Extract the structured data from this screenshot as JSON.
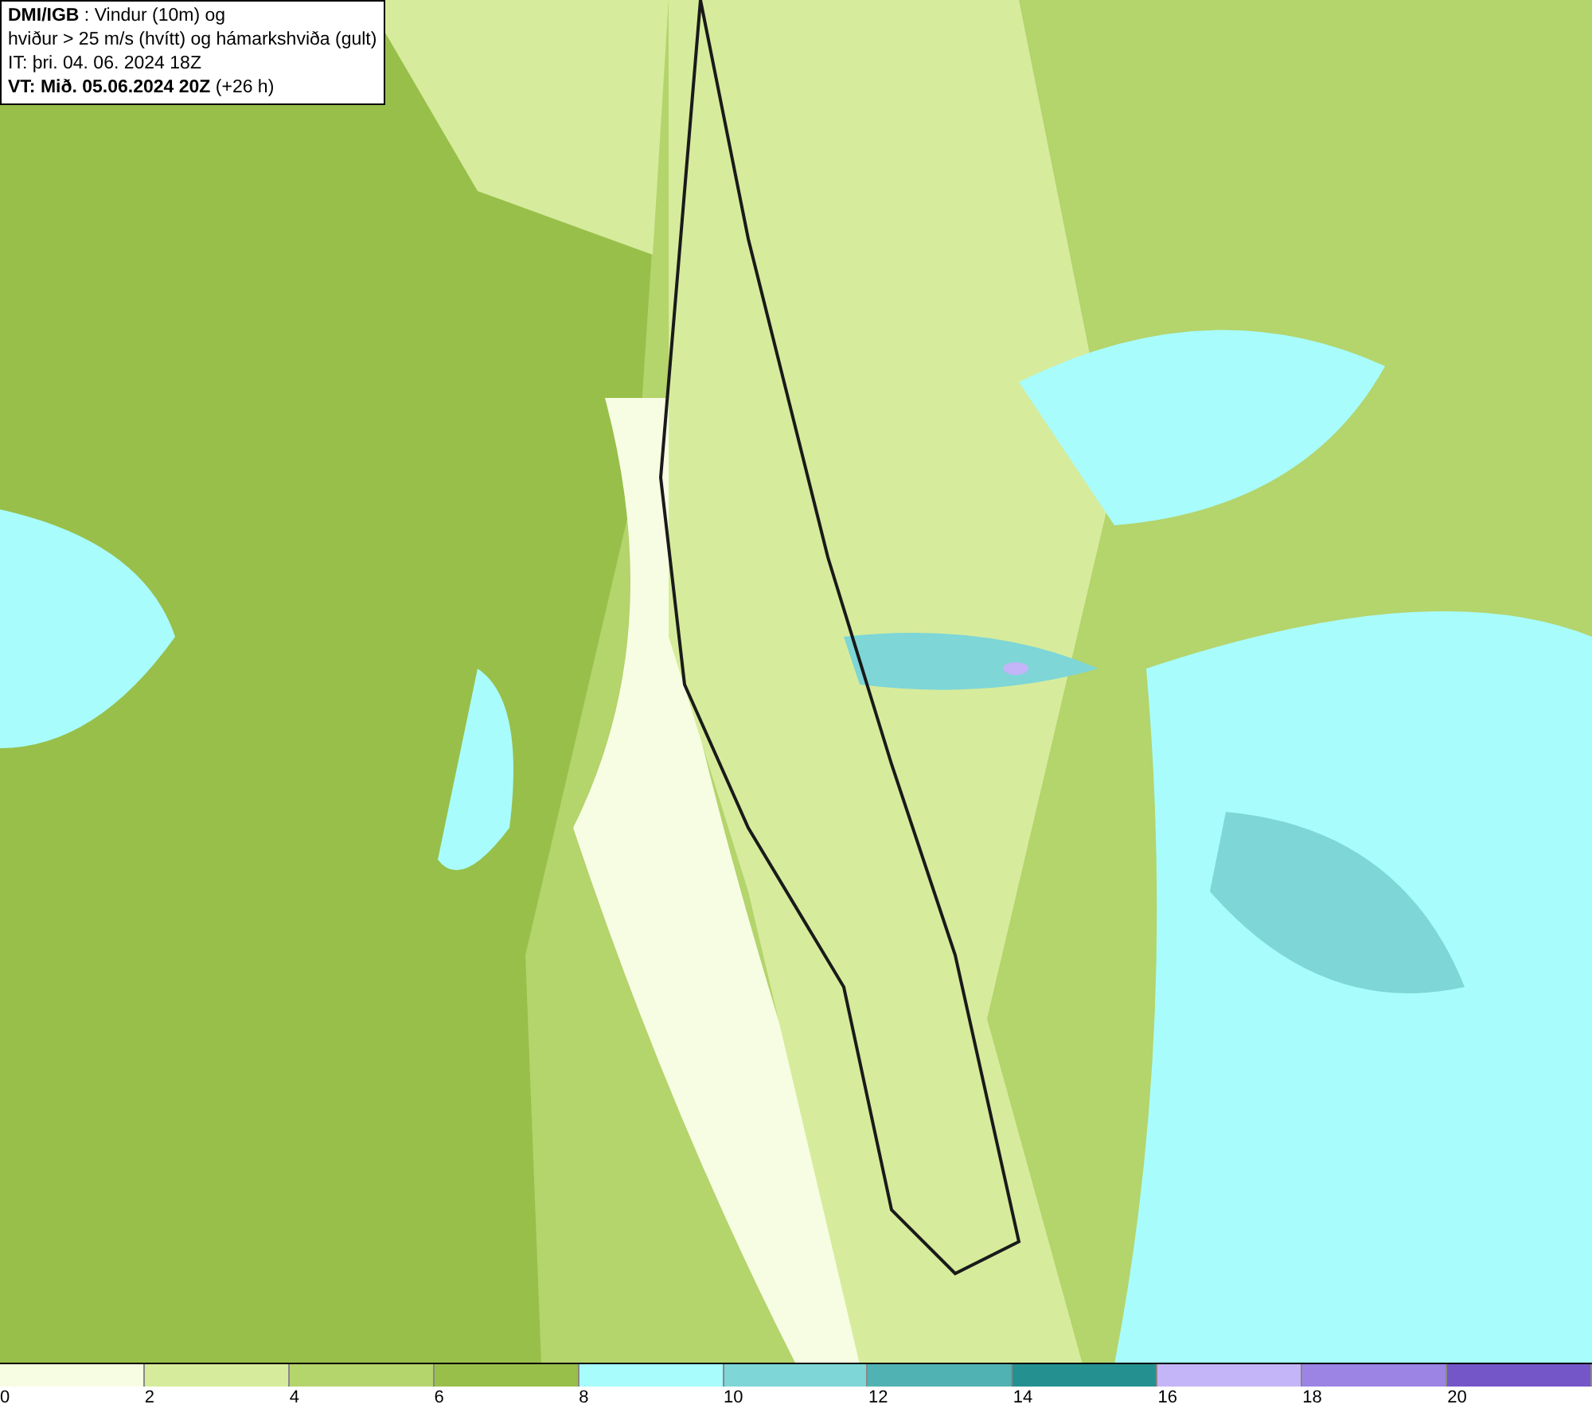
{
  "header": {
    "lines": [
      "**DMI/IGB** : Vindur (10m) og",
      "hviður > 25 m/s (hvítt) og hámarkshviða (gult)",
      "IT: þri. 04. 06. 2024 18Z",
      "**VT: Mið. 05.06.2024 20Z** (+26 h)"
    ]
  },
  "legend": [
    {
      "label": "0",
      "color": "#f7fde3"
    },
    {
      "label": "2",
      "color": "#d6ec9c"
    },
    {
      "label": "4",
      "color": "#b4d46c"
    },
    {
      "label": "6",
      "color": "#98bf4a"
    },
    {
      "label": "8",
      "color": "#a8fcfc"
    },
    {
      "label": "10",
      "color": "#7ed6d6"
    },
    {
      "label": "12",
      "color": "#50b2b2"
    },
    {
      "label": "14",
      "color": "#249090"
    },
    {
      "label": "16",
      "color": "#c4b4f8"
    },
    {
      "label": "18",
      "color": "#9c84e4"
    },
    {
      "label": "20",
      "color": "#7456c8"
    }
  ]
}
